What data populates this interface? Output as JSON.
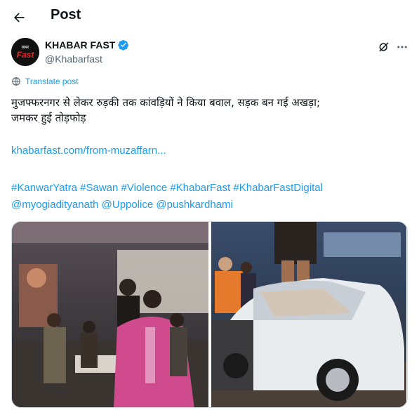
{
  "header": {
    "title": "Post"
  },
  "author": {
    "name": "KHABAR FAST",
    "handle": "@Khabarfast",
    "avatar_text_small": "खबर",
    "avatar_text_big": "Fast"
  },
  "translate_label": "Translate post",
  "tweet": {
    "line1": "मुजफ्फरनगर से लेकर रुड़की तक कांवड़ियों ने किया बवाल, सड़क बन गई अखड़ा;",
    "line2": "जमकर हुई तोड़फोड़",
    "link": "khabarfast.com/from-muzaffarn...",
    "hashtags": [
      "#KanwarYatra",
      "#Sawan",
      "#Violence",
      "#KhabarFast",
      "#KhabarFastDigital"
    ],
    "mentions": [
      "@myogiadityanath",
      "@Uppolice",
      "@pushkardhami"
    ]
  },
  "colors": {
    "accent": "#1d9bf0",
    "verified": "#1d9bf0",
    "muted": "#536471"
  },
  "icons": {
    "back": "arrow-left-icon",
    "verified": "verified-badge-icon",
    "grok": "grok-icon",
    "more": "more-icon",
    "translate": "translate-icon"
  }
}
